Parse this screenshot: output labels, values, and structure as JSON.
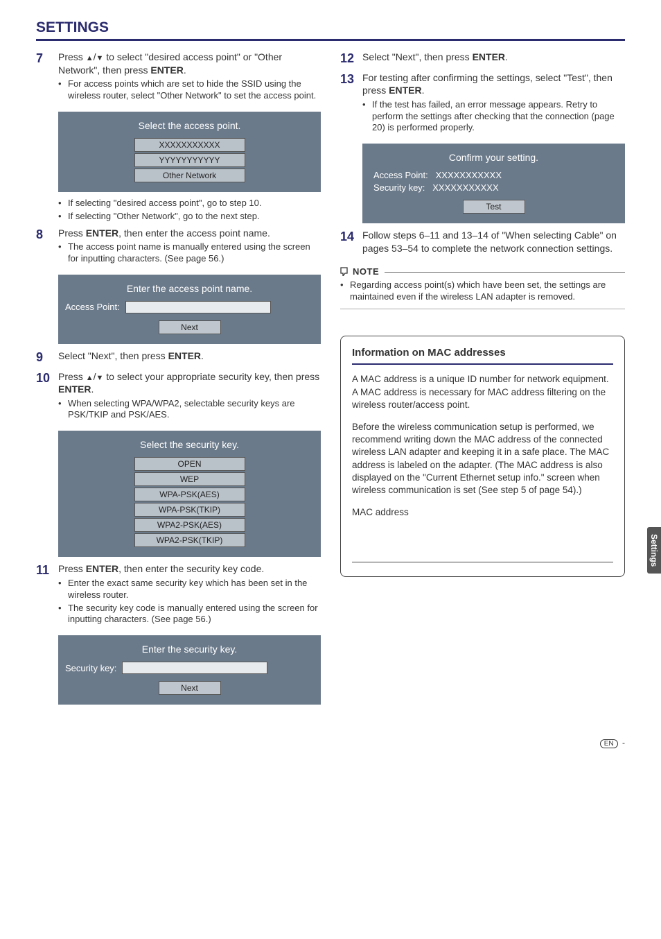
{
  "title": "SETTINGS",
  "sideTab": "Settings",
  "footer_en": "EN",
  "footer_dash": " - ",
  "left": {
    "s7": {
      "num": "7",
      "line": "Press ▲/▼ to select \"desired access point\" or \"Other Network\", then press ENTER.",
      "b1": "For access points which are set to hide the SSID using the wireless router, select \"Other Network\" to set the access point.",
      "after_b1": "If selecting \"desired access point\", go to step 10.",
      "after_b2": "If selecting \"Other Network\", go to the next step."
    },
    "scr7": {
      "title": "Select the access point.",
      "i1": "XXXXXXXXXXX",
      "i2": "YYYYYYYYYYY",
      "i3": "Other Network"
    },
    "s8": {
      "num": "8",
      "line": "Press ENTER, then enter the access point name.",
      "b1": "The access point name is manually entered using the screen for inputting characters. (See page 56.)"
    },
    "scr8": {
      "title": "Enter the access point name.",
      "label": "Access Point:",
      "btn": "Next"
    },
    "s9": {
      "num": "9",
      "line": "Select \"Next\", then press ENTER."
    },
    "s10": {
      "num": "10",
      "line": "Press ▲/▼ to select your appropriate security key, then press ENTER.",
      "b1": "When selecting WPA/WPA2, selectable security keys are PSK/TKIP and PSK/AES."
    },
    "scr10": {
      "title": "Select the security key.",
      "i1": "OPEN",
      "i2": "WEP",
      "i3": "WPA-PSK(AES)",
      "i4": "WPA-PSK(TKIP)",
      "i5": "WPA2-PSK(AES)",
      "i6": "WPA2-PSK(TKIP)"
    },
    "s11": {
      "num": "11",
      "line": "Press ENTER, then enter the security key code.",
      "b1": "Enter the exact same security key which has been set in the wireless router.",
      "b2": "The security key code is manually entered using the screen for inputting characters. (See page 56.)"
    },
    "scr11": {
      "title": "Enter the security key.",
      "label": "Security key:",
      "btn": "Next"
    }
  },
  "right": {
    "s12": {
      "num": "12",
      "line": "Select \"Next\", then press ENTER."
    },
    "s13": {
      "num": "13",
      "line": "For testing after confirming the settings, select \"Test\", then press ENTER.",
      "b1": "If the test has failed, an error message appears. Retry to perform the settings after checking that the connection (page 20) is performed properly."
    },
    "scr13": {
      "title": "Confirm your setting.",
      "k1": "Access Point:",
      "v1": "XXXXXXXXXXX",
      "k2": "Security key:",
      "v2": "XXXXXXXXXXX",
      "btn": "Test"
    },
    "s14": {
      "num": "14",
      "line": "Follow steps 6–11 and 13–14 of \"When selecting Cable\" on pages 53–54 to complete the network connection settings."
    },
    "note": {
      "label": "NOTE",
      "body": "Regarding access point(s) which have been set, the settings are maintained even if the wireless LAN adapter is removed."
    },
    "info": {
      "head": "Information on MAC addresses",
      "p1": "A MAC address is a unique ID number for network equipment. A MAC address is necessary for MAC address filtering on the wireless router/access point.",
      "p2": "Before the wireless communication setup is performed, we recommend writing down the MAC address of the connected wireless LAN adapter and keeping it in a safe place. The MAC address is labeled on the adapter. (The MAC address is also displayed on the \"Current Ethernet setup info.\" screen when wireless communication is set (See step 5 of page 54).)",
      "mac_label": "MAC address"
    }
  }
}
